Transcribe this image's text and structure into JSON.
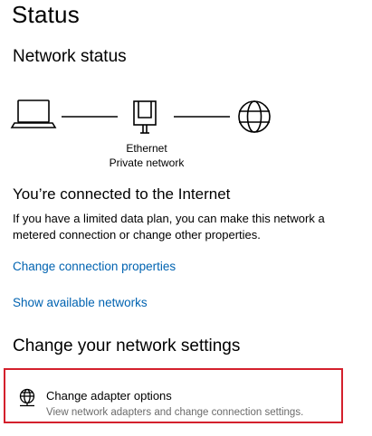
{
  "page": {
    "title": "Status"
  },
  "network_status": {
    "title": "Network status",
    "connection_type": "Ethernet",
    "network_profile": "Private network",
    "icons": [
      "laptop-icon",
      "ethernet-icon",
      "globe-icon"
    ]
  },
  "connection": {
    "heading": "You’re connected to the Internet",
    "description": "If you have a limited data plan, you can make this network a metered connection or change other properties.",
    "change_properties_link": "Change connection properties",
    "show_networks_link": "Show available networks"
  },
  "change_settings": {
    "title": "Change your network settings",
    "adapter_option": {
      "title": "Change adapter options",
      "description": "View network adapters and change connection settings.",
      "icon": "adapter-globe-icon"
    }
  },
  "colors": {
    "link": "#0063b1",
    "highlight_border": "#d4202c",
    "secondary_text": "#6b6b6b"
  }
}
